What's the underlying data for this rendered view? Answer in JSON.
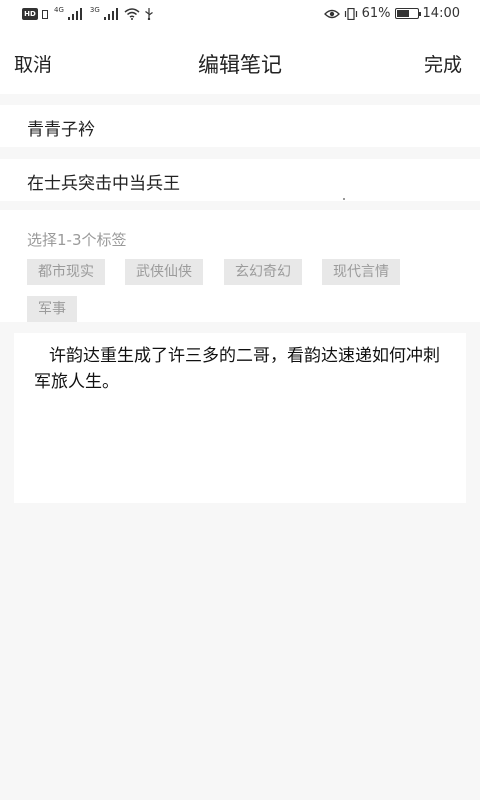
{
  "status_bar": {
    "hd_badge": "HD",
    "net_4g": "4G",
    "net_3g": "3G",
    "battery_percent": "61%",
    "battery_level": 0.61,
    "time": "14:00",
    "icons": [
      "hd-icon",
      "sim-icon",
      "signal-icon",
      "wifi-icon",
      "usb-icon",
      "eye-icon",
      "vibrate-icon",
      "battery-icon"
    ]
  },
  "header": {
    "cancel_label": "取消",
    "title": "编辑笔记",
    "done_label": "完成"
  },
  "form": {
    "author_value": "青青子衿",
    "book_value": "在士兵突击中当兵王"
  },
  "tags": {
    "hint": "选择1-3个标签",
    "items": [
      "都市现实",
      "武侠仙侠",
      "玄幻奇幻",
      "现代言情",
      "军事"
    ]
  },
  "content": {
    "text": "许韵达重生成了许三多的二哥，看韵达速递如何冲刺军旅人生。"
  }
}
